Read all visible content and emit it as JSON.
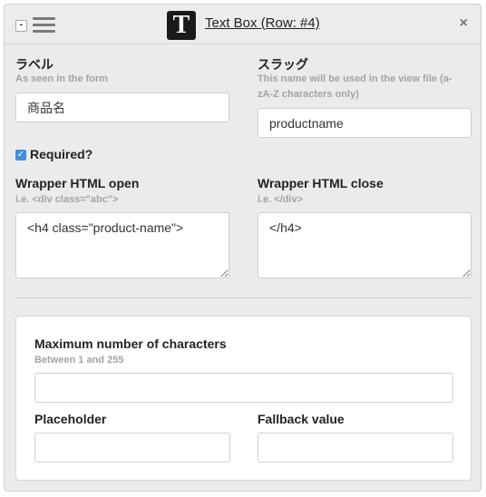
{
  "header": {
    "collapse_symbol": "-",
    "type_icon_letter": "T",
    "title": "Text Box (Row: #4)",
    "close_symbol": "×"
  },
  "fields": {
    "label": {
      "title": "ラベル",
      "help": "As seen in the form",
      "value": "商品名"
    },
    "slug": {
      "title": "スラッグ",
      "help_line1": "This name will be used in the view file (a-",
      "help_line2": "zA-Z characters only)",
      "value": "productname"
    },
    "required": {
      "label": "Required?",
      "checked": true
    },
    "wrapper_open": {
      "title": "Wrapper HTML open",
      "help": "i.e. <div class=\"abc\">",
      "value": "<h4 class=\"product-name\">"
    },
    "wrapper_close": {
      "title": "Wrapper HTML close",
      "help": "i.e. </div>",
      "value": "</h4>"
    }
  },
  "options": {
    "max_chars": {
      "title": "Maximum number of characters",
      "help": "Between 1 and 255",
      "value": ""
    },
    "placeholder": {
      "title": "Placeholder",
      "value": ""
    },
    "fallback": {
      "title": "Fallback value",
      "value": ""
    }
  }
}
